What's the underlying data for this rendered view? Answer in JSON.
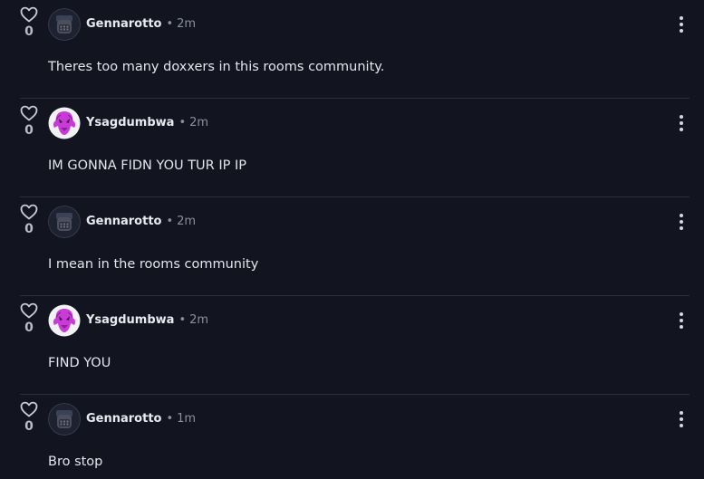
{
  "comments": [
    {
      "votes": "0",
      "username": "Gennarotto",
      "separator": "•",
      "time": "2m",
      "text": "Theres too many doxxers in this rooms community.",
      "avatar": "dark-character-avatar"
    },
    {
      "votes": "0",
      "username": "Ysagdumbwa",
      "separator": "•",
      "time": "2m",
      "text": "IM GONNA FIDN YOU TUR IP IP",
      "avatar": "purple-character-avatar"
    },
    {
      "votes": "0",
      "username": "Gennarotto",
      "separator": "•",
      "time": "2m",
      "text": "I mean in the rooms community",
      "avatar": "dark-character-avatar"
    },
    {
      "votes": "0",
      "username": "Ysagdumbwa",
      "separator": "•",
      "time": "2m",
      "text": "FIND YOU",
      "avatar": "purple-character-avatar"
    },
    {
      "votes": "0",
      "username": "Gennarotto",
      "separator": "•",
      "time": "1m",
      "text": "Bro stop",
      "avatar": "dark-character-avatar"
    }
  ],
  "colors": {
    "background": "#121420",
    "divider": "#2b2e3d",
    "muted_text": "#8b8fa0",
    "purple_accent": "#c93bd6"
  }
}
